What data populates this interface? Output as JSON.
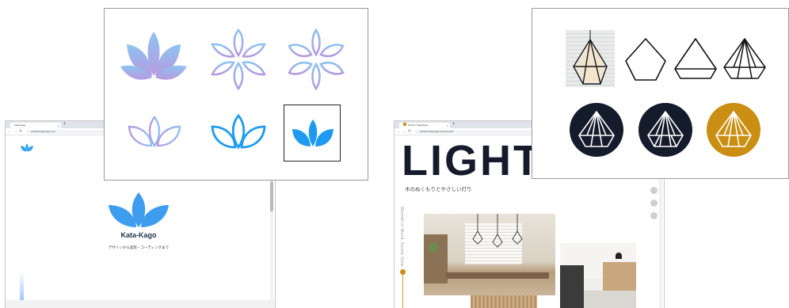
{
  "kata_kago_window": {
    "tab_title": "Kata-Kago",
    "url": "portfolio.kata-kago.com",
    "logo_text": "Kata-Kago",
    "tagline": "デザインから実装・コーディングまで"
  },
  "light_window": {
    "tab_title": "LIGHT | Kata-Kago",
    "url": "portfolio.kata-kago.com/works/2",
    "hero_title": "LIGHT",
    "hero_subtitle": "木のぬくもりとやさしい灯り",
    "vertical_caption": "Warmth of Wood, Gentle Glow"
  },
  "colors": {
    "lotus_gradient_start": "#8fc3f0",
    "lotus_gradient_end": "#b69ae0",
    "lotus_blue": "#1e9bf0",
    "lamp_navy": "#141b2b",
    "lamp_gold": "#c98e12",
    "lamp_gold_line": "#c99a2a"
  },
  "icons": [
    "lotus-icon",
    "diamond-lamp-icon",
    "share-icon",
    "facebook-icon",
    "instagram-icon"
  ]
}
